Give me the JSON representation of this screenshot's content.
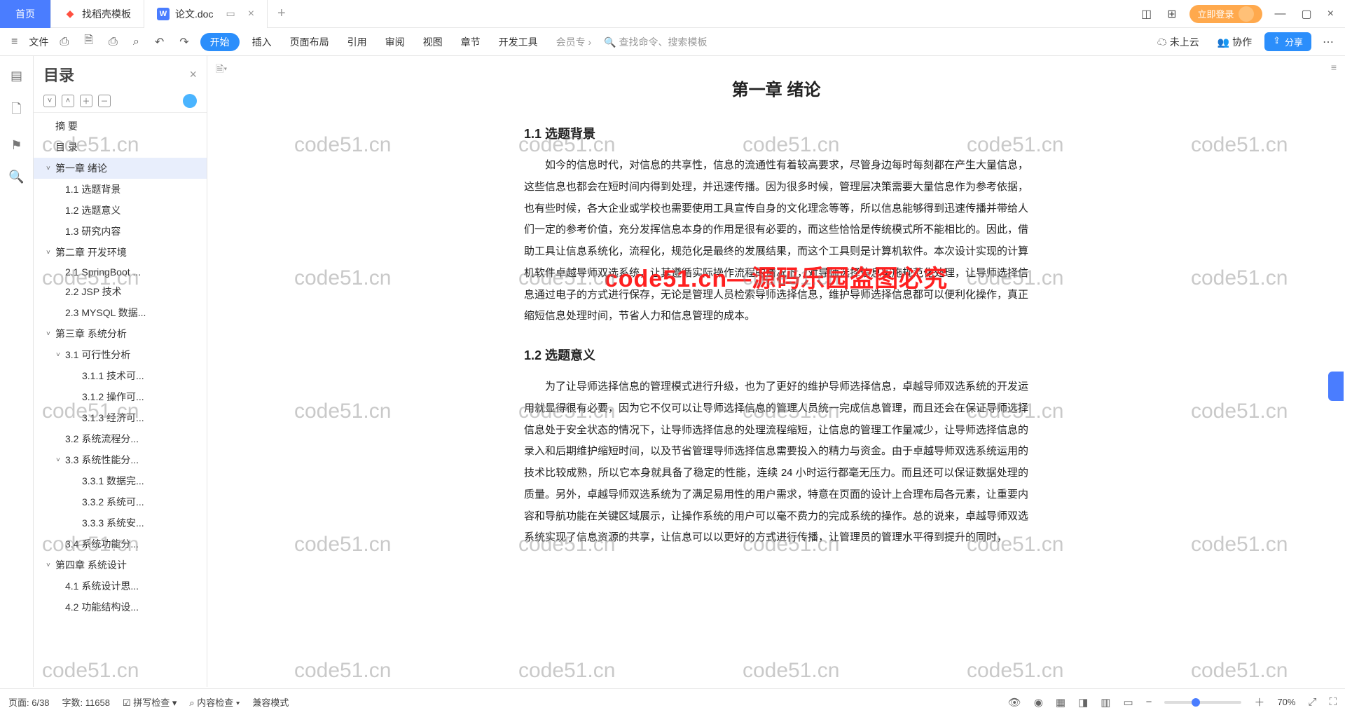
{
  "titlebar": {
    "home": "首页",
    "tab1": "找稻壳模板",
    "tab2": "论文.doc",
    "login": "立即登录"
  },
  "toolbar": {
    "file": "文件",
    "start": "开始",
    "insert": "插入",
    "layout": "页面布局",
    "ref": "引用",
    "review": "审阅",
    "view": "视图",
    "chapter": "章节",
    "dev": "开发工具",
    "member": "会员专",
    "search": "查找命令、搜索模板",
    "cloud": "未上云",
    "collab": "协作",
    "share": "分享"
  },
  "outline": {
    "title": "目录",
    "items": [
      {
        "t": "摘  要",
        "d": 0
      },
      {
        "t": "目  录",
        "d": 0
      },
      {
        "t": "第一章  绪论",
        "d": 0,
        "c": 1,
        "sel": 1
      },
      {
        "t": "1.1  选题背景",
        "d": 1
      },
      {
        "t": "1.2  选题意义",
        "d": 1
      },
      {
        "t": "1.3  研究内容",
        "d": 1
      },
      {
        "t": "第二章  开发环境",
        "d": 0,
        "c": 1
      },
      {
        "t": "2.1 SpringBoot ...",
        "d": 1
      },
      {
        "t": "2.2 JSP 技术",
        "d": 1
      },
      {
        "t": "2.3 MYSQL 数据...",
        "d": 1
      },
      {
        "t": "第三章  系统分析",
        "d": 0,
        "c": 1
      },
      {
        "t": "3.1 可行性分析",
        "d": 1,
        "c": 1
      },
      {
        "t": "3.1.1 技术可...",
        "d": 2
      },
      {
        "t": "3.1.2 操作可...",
        "d": 2
      },
      {
        "t": "3.1.3 经济可...",
        "d": 2
      },
      {
        "t": "3.2 系统流程分...",
        "d": 1
      },
      {
        "t": "3.3 系统性能分...",
        "d": 1,
        "c": 1
      },
      {
        "t": "3.3.1 数据完...",
        "d": 2
      },
      {
        "t": "3.3.2 系统可...",
        "d": 2
      },
      {
        "t": "3.3.3 系统安...",
        "d": 2
      },
      {
        "t": "3.4 系统功能分...",
        "d": 1
      },
      {
        "t": "第四章  系统设计",
        "d": 0,
        "c": 1
      },
      {
        "t": "4.1  系统设计思...",
        "d": 1
      },
      {
        "t": "4.2  功能结构设...",
        "d": 1
      }
    ]
  },
  "doc": {
    "chapter": "第一章  绪论",
    "s11": "1.1  选题背景",
    "p11": "如今的信息时代，对信息的共享性，信息的流通性有着较高要求，尽管身边每时每刻都在产生大量信息，这些信息也都会在短时间内得到处理，并迅速传播。因为很多时候，管理层决策需要大量信息作为参考依据，也有些时候，各大企业或学校也需要使用工具宣传自身的文化理念等等，所以信息能够得到迅速传播并带给人们一定的参考价值，充分发挥信息本身的作用是很有必要的，而这些恰恰是传统模式所不能相比的。因此，借助工具让信息系统化，流程化，规范化是最终的发展结果，而这个工具则是计算机软件。本次设计实现的计算机软件卓越导师双选系统，让其遵循实际操作流程的情况下，对导师选择信息实施规范化处理，让导师选择信息通过电子的方式进行保存，无论是管理人员检索导师选择信息，维护导师选择信息都可以便利化操作，真正缩短信息处理时间，节省人力和信息管理的成本。",
    "s12": "1.2  选题意义",
    "p12": "为了让导师选择信息的管理模式进行升级，也为了更好的维护导师选择信息，卓越导师双选系统的开发运用就显得很有必要，因为它不仅可以让导师选择信息的管理人员统一完成信息管理，而且还会在保证导师选择信息处于安全状态的情况下，让导师选择信息的处理流程缩短，让信息的管理工作量减少，让导师选择信息的录入和后期维护缩短时间，以及节省管理导师选择信息需要投入的精力与资金。由于卓越导师双选系统运用的技术比较成熟，所以它本身就具备了稳定的性能，连续 24 小时运行都毫无压力。而且还可以保证数据处理的质量。另外，卓越导师双选系统为了满足易用性的用户需求，特意在页面的设计上合理布局各元素，让重要内容和导航功能在关键区域展示，让操作系统的用户可以毫不费力的完成系统的操作。总的说来，卓越导师双选系统实现了信息资源的共享，让信息可以以更好的方式进行传播，让管理员的管理水平得到提升的同时，"
  },
  "overlay": "code51.cn—源码乐园盗图必究",
  "wm": "code51.cn",
  "status": {
    "page": "页面: 6/38",
    "words": "字数: 11658",
    "spell": "拼写检查",
    "content": "内容检查",
    "compat": "兼容模式",
    "zoom": "70%"
  }
}
